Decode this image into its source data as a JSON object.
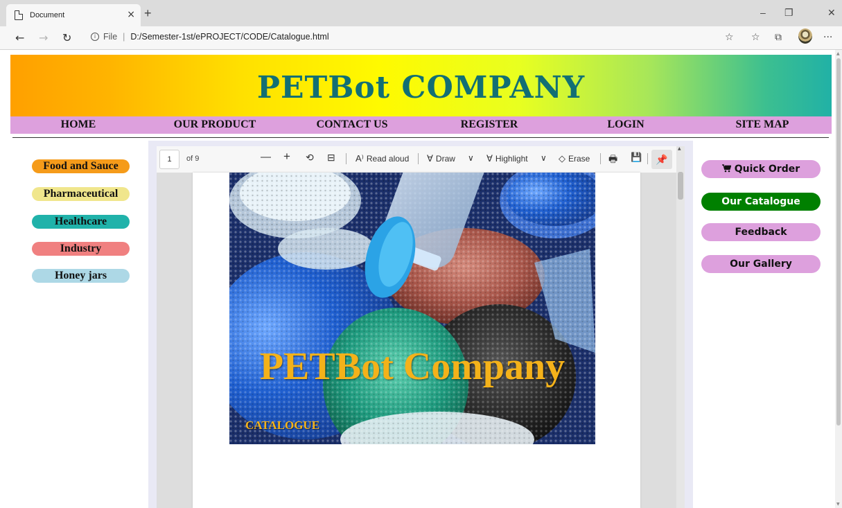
{
  "browser": {
    "tab_title": "Document",
    "tab_close": "×",
    "new_tab": "+",
    "minimize": "–",
    "restore": "❐",
    "close": "✕",
    "back": "←",
    "forward": "→",
    "refresh": "↻",
    "info_glyph": "i",
    "file_label": "File",
    "url_sep": "|",
    "url": "D:/Semester-1st/ePROJECT/CODE/Catalogue.html",
    "favorite": "☆",
    "favorites_list": "☆",
    "collections": "⧉",
    "more": "···"
  },
  "header": {
    "title": "PETBot COMPANY",
    "gradient_colors": [
      "#ffa000",
      "#fffa00",
      "#21b1a6"
    ],
    "title_color": "#126f74"
  },
  "nav": {
    "items": [
      "HOME",
      "OUR PRODUCT",
      "CONTACT US",
      "REGISTER",
      "LOGIN",
      "SITE MAP"
    ],
    "background": "#dda0dd"
  },
  "left_menu": {
    "items": [
      {
        "label": "Food and Sauce",
        "color": "#f59b1a"
      },
      {
        "label": "Pharmaceutical",
        "color": "#f0e68c"
      },
      {
        "label": "Healthcare",
        "color": "#20b2aa"
      },
      {
        "label": "Industry",
        "color": "#f08080"
      },
      {
        "label": "Honey jars",
        "color": "#add8e6"
      }
    ]
  },
  "right_menu": {
    "cart_icon": "🛒",
    "items": [
      {
        "label": "Quick Order",
        "bg": "#dda0dd",
        "fg": "#111111"
      },
      {
        "label": "Our Catalogue",
        "bg": "#008000",
        "fg": "#ffffff"
      },
      {
        "label": "Feedback",
        "bg": "#dda0dd",
        "fg": "#111111"
      },
      {
        "label": "Our Gallery",
        "bg": "#dda0dd",
        "fg": "#111111"
      }
    ]
  },
  "pdf_viewer": {
    "page_number": "1",
    "page_total": "of 9",
    "zoom_out": "—",
    "zoom_in": "+",
    "rotate": "⟲",
    "fit": "⊟",
    "read_aloud_icon": "A⁾",
    "read_aloud": "Read aloud",
    "draw_icon": "∀",
    "draw": "Draw",
    "highlight_icon": "∀",
    "highlight": "Highlight",
    "erase_icon": "◇",
    "erase": "Erase",
    "chevron": "∨",
    "print": "🖶",
    "save": "💾",
    "pin": "📌"
  },
  "cover": {
    "title": "PETBot Company",
    "subtitle": "CATALOGUE",
    "text_color": "#f4b21a"
  }
}
